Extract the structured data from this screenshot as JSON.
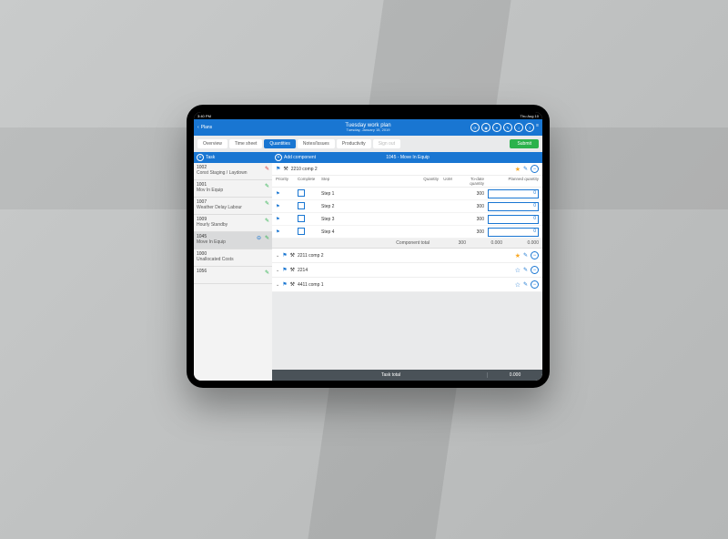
{
  "status": {
    "time": "3:40 PM",
    "date": "Thu Aug 10"
  },
  "nav": {
    "back": "Plans"
  },
  "header": {
    "title": "Tuesday work plan",
    "subtitle": "Tuesday, January 15, 2019"
  },
  "tabs": {
    "overview": "Overview",
    "timesheet": "Time sheet",
    "quantities": "Quantities",
    "notes": "Notes/Issues",
    "productivity": "Productivity",
    "signout": "Sign out",
    "submit": "Submit"
  },
  "sidebar": {
    "header": "Task",
    "add_comp": "Add component",
    "tasks": [
      {
        "id": "1002",
        "name": "Const Staging / Laydown",
        "pen": "red"
      },
      {
        "id": "1001",
        "name": "Mov In Equip",
        "pen": "green"
      },
      {
        "id": "1007",
        "name": "Weather Delay Labour",
        "pen": "green"
      },
      {
        "id": "1009",
        "name": "Hourly Standby",
        "pen": "green"
      },
      {
        "id": "1045",
        "name": "Move In Equip",
        "pen": "green",
        "sel": true,
        "extra": "blue"
      },
      {
        "id": "1000",
        "name": "Unallocated Costs",
        "pen": ""
      },
      {
        "id": "1056",
        "name": "",
        "pen": "green"
      }
    ]
  },
  "main": {
    "title": "1045 - Move In Equip",
    "active_comp": {
      "name": "2210 comp 2",
      "steps_header": {
        "priority": "Priority",
        "complete": "Complete",
        "step": "Step",
        "quantity": "Quantity",
        "uom": "UoM",
        "todate": "To-date quantity",
        "planned": "Planned quantity"
      },
      "steps": [
        {
          "name": "Step 1",
          "qty": "",
          "tdq": "300",
          "pq": "0"
        },
        {
          "name": "Step 2",
          "qty": "",
          "tdq": "300",
          "pq": "0"
        },
        {
          "name": "Step 3",
          "qty": "",
          "tdq": "300",
          "pq": "0"
        },
        {
          "name": "Step 4",
          "qty": "",
          "tdq": "300",
          "pq": "0"
        }
      ],
      "total": {
        "label": "Component total",
        "qty": "300",
        "tdq": "0.000",
        "pq": "0.000"
      }
    },
    "other_comps": [
      {
        "name": "2211 comp 2",
        "star": "filled"
      },
      {
        "name": "2214",
        "star": "empty"
      },
      {
        "name": "4411 comp 1",
        "star": "empty"
      }
    ],
    "task_total": {
      "label": "Task total",
      "val1": "",
      "val2": "0.000"
    }
  }
}
